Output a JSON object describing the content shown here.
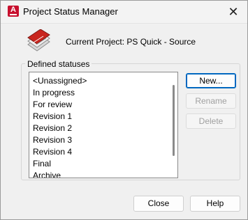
{
  "window": {
    "title": "Project Status Manager",
    "app_icon_letter": "A",
    "close_glyph": "✕"
  },
  "project": {
    "icon": "project-sheets-icon",
    "label": "Current Project: PS Quick - Source"
  },
  "statuses": {
    "group_label": "Defined statuses",
    "items": [
      "<Unassigned>",
      "In progress",
      "For review",
      "Revision 1",
      "Revision 2",
      "Revision 3",
      "Revision 4",
      "Final",
      "Archive"
    ]
  },
  "buttons": {
    "new": "New...",
    "rename": "Rename",
    "delete": "Delete",
    "close": "Close",
    "help": "Help"
  },
  "colors": {
    "accent": "#0067c0",
    "app_icon": "#c8102e",
    "disabled_text": "#a0a0a0"
  }
}
